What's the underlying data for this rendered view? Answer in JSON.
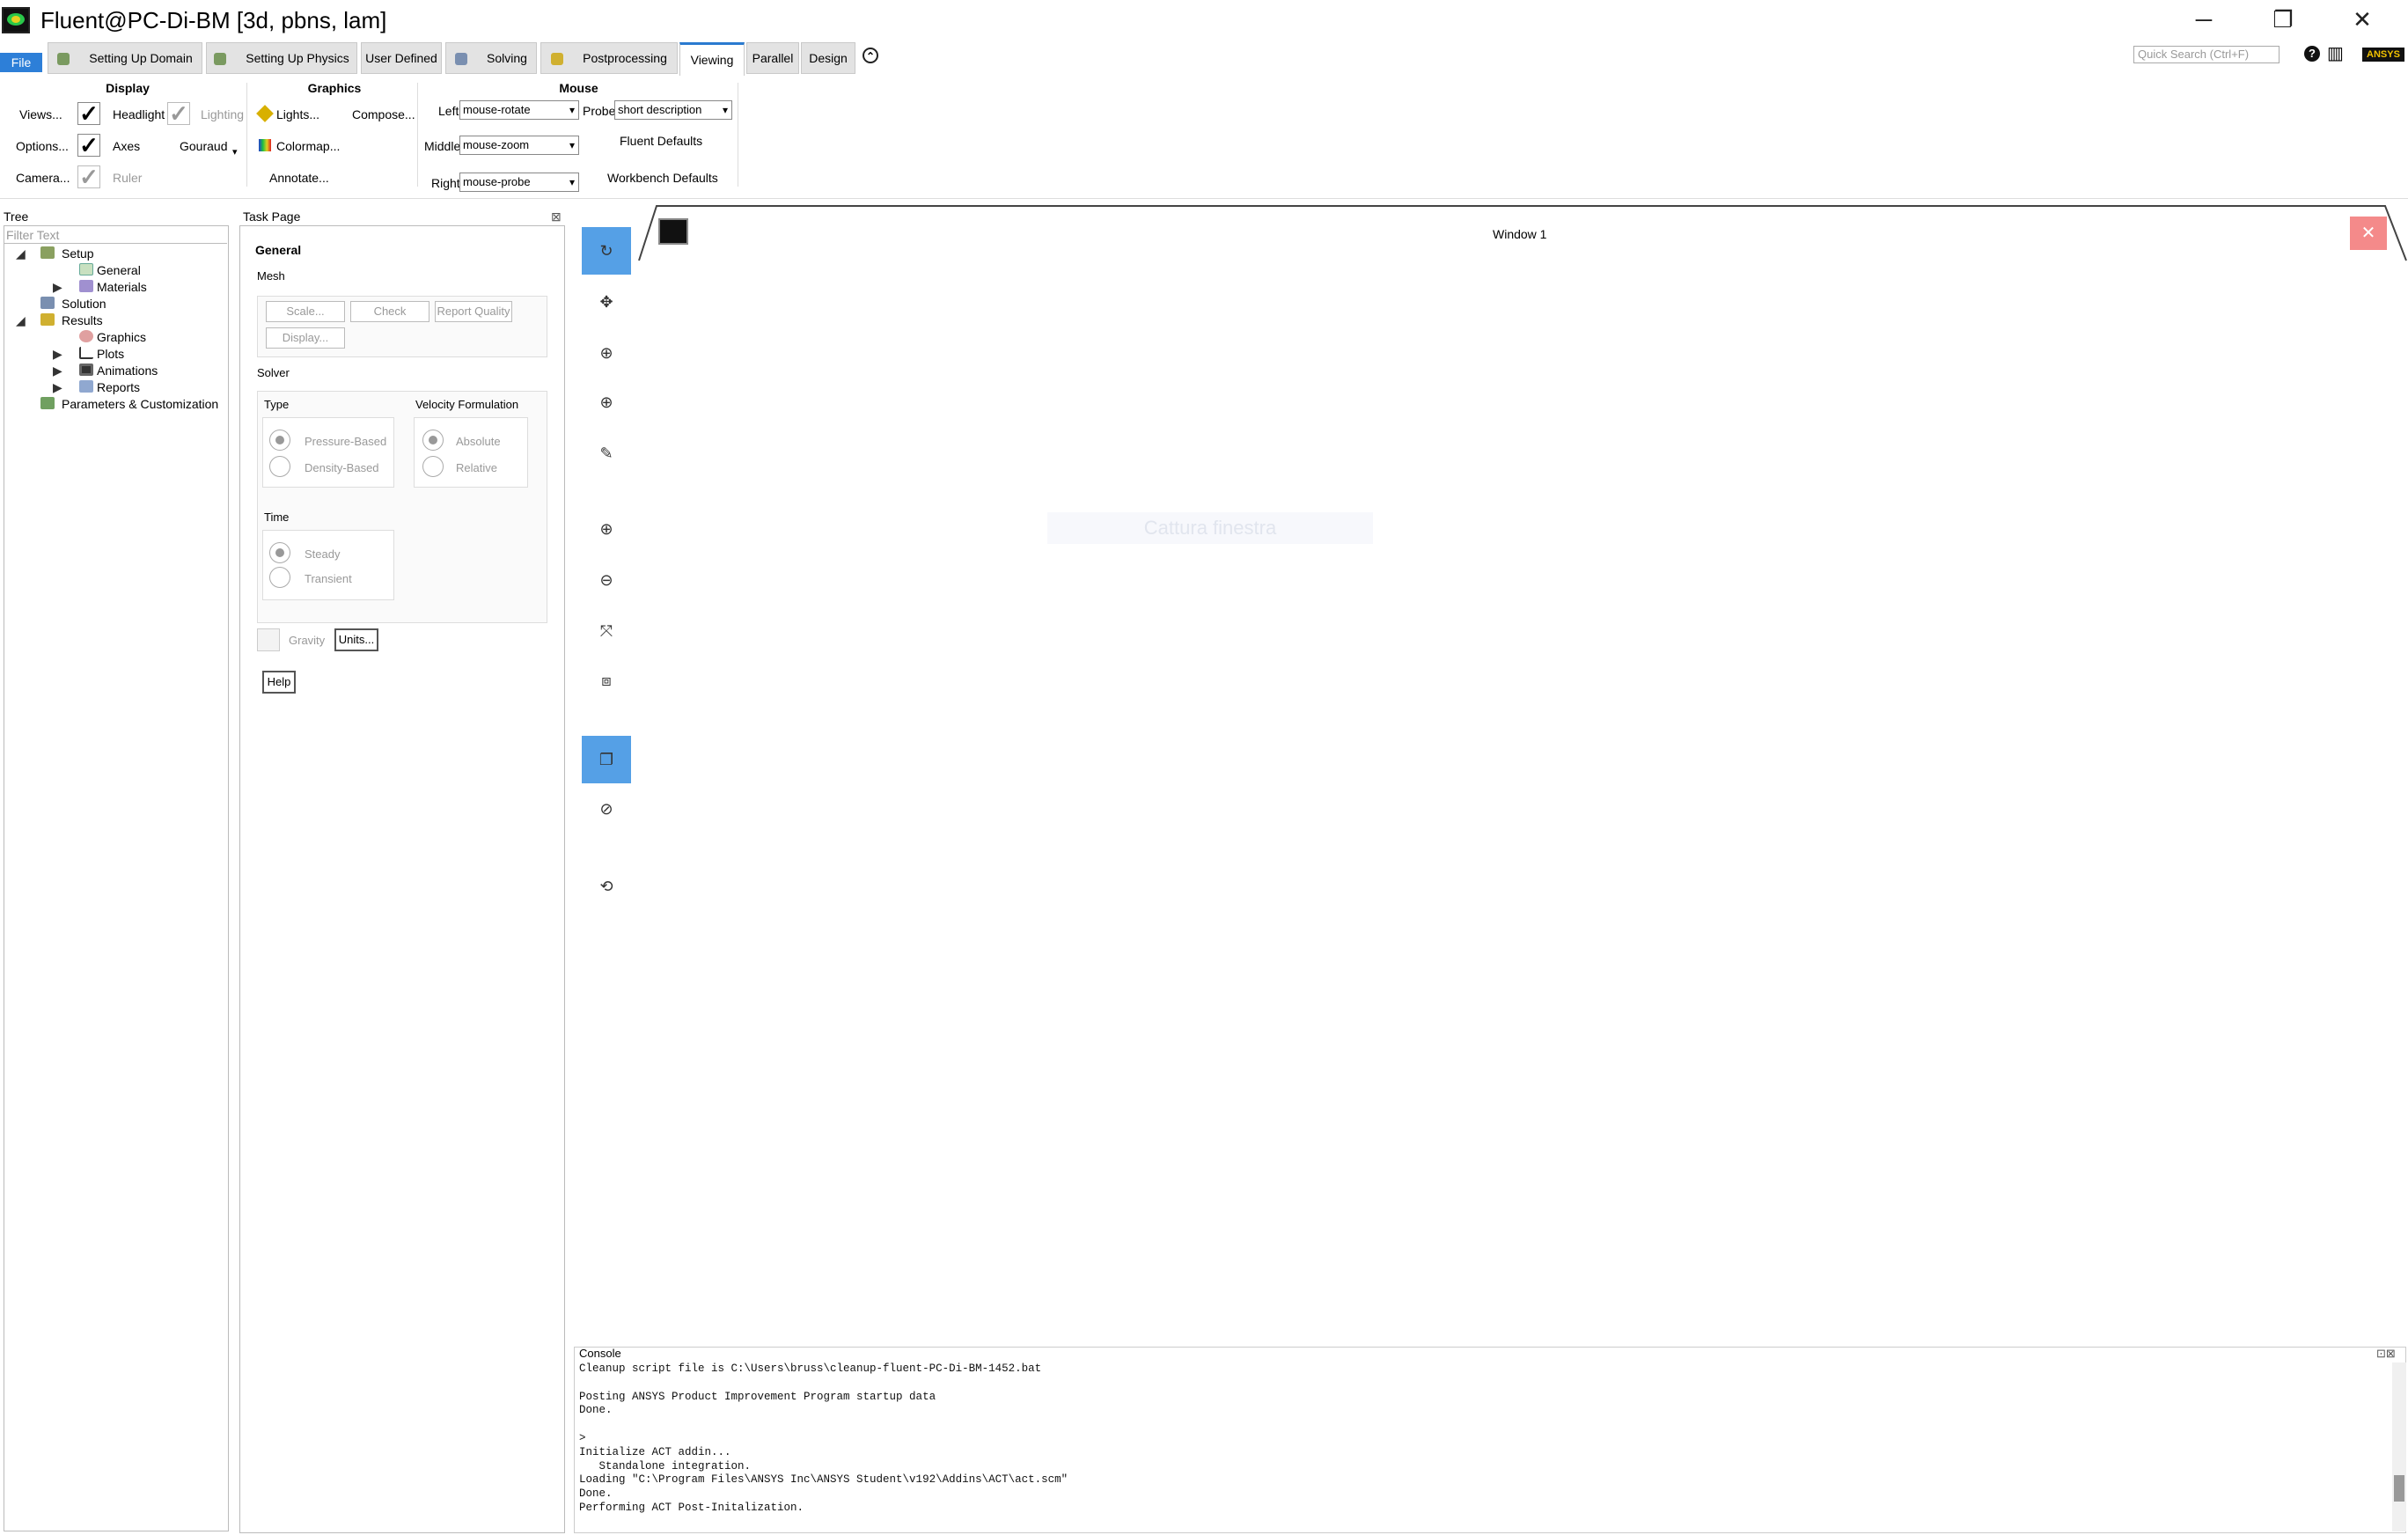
{
  "window": {
    "title": "Fluent@PC-Di-BM  [3d, pbns, lam]",
    "minimize_icon": "minimize-icon",
    "restore_icon": "restore-icon",
    "close_icon": "close-icon",
    "min_glyph": "─",
    "restore_glyph": "❐",
    "close_glyph": "✕"
  },
  "tabs": {
    "file": "File",
    "items": [
      "Setting Up Domain",
      "Setting Up Physics",
      "User Defined",
      "Solving",
      "Postprocessing",
      "Viewing",
      "Parallel",
      "Design"
    ],
    "active": "Viewing",
    "collapse_glyph": "⌃"
  },
  "topright": {
    "search_placeholder": "Quick Search (Ctrl+F)",
    "help_glyph": "?",
    "layout_glyph": "▥",
    "brand": "ANSYS"
  },
  "ribbon": {
    "display": {
      "title": "Display",
      "views": "Views...",
      "options": "Options...",
      "camera": "Camera...",
      "headlight": "Headlight",
      "axes": "Axes",
      "ruler": "Ruler",
      "lighting": "Lighting",
      "gouraud": "Gouraud",
      "gouraud_arrow": "▾"
    },
    "graphics": {
      "title": "Graphics",
      "lights": "Lights...",
      "compose": "Compose...",
      "colormap": "Colormap...",
      "annotate": "Annotate..."
    },
    "mouse": {
      "title": "Mouse",
      "left_label": "Left",
      "left_value": "mouse-rotate",
      "middle_label": "Middle",
      "middle_value": "mouse-zoom",
      "right_label": "Right",
      "right_value": "mouse-probe",
      "probe_label": "Probe",
      "probe_value": "short description",
      "fluent_defaults": "Fluent Defaults",
      "workbench_defaults": "Workbench Defaults"
    }
  },
  "tree": {
    "title": "Tree",
    "filter_placeholder": "Filter Text",
    "items": [
      "Setup",
      "General",
      "Materials",
      "Solution",
      "Results",
      "Graphics",
      "Plots",
      "Animations",
      "Reports",
      "Parameters & Customization"
    ],
    "expanded_glyph": "◢",
    "collapsed_glyph": "▶"
  },
  "task": {
    "title": "Task Page",
    "heading": "General",
    "mesh": "Mesh",
    "scale": "Scale...",
    "check": "Check",
    "report_quality": "Report Quality",
    "display": "Display...",
    "solver": "Solver",
    "type": "Type",
    "pressure_based": "Pressure-Based",
    "density_based": "Density-Based",
    "velocity": "Velocity Formulation",
    "absolute": "Absolute",
    "relative": "Relative",
    "time": "Time",
    "steady": "Steady",
    "transient": "Transient",
    "gravity": "Gravity",
    "units": "Units...",
    "help": "Help",
    "close_glyph": "⊠"
  },
  "graphics_window": {
    "title": "Window 1",
    "tooltip": "Cattura finestra",
    "close_glyph": "✕",
    "tools": [
      "↻",
      "✥",
      "⊕",
      "⊕",
      "✎",
      "⊕",
      "⊖",
      "⤧",
      "⧈",
      "❐",
      "⊘",
      "⟲"
    ]
  },
  "console": {
    "title": "Console",
    "lines": [
      "Cleanup script file is C:\\Users\\bruss\\cleanup-fluent-PC-Di-BM-1452.bat",
      "",
      "Posting ANSYS Product Improvement Program startup data",
      "Done.",
      "",
      "> ",
      "Initialize ACT addin...",
      "   Standalone integration.",
      "Loading \"C:\\Program Files\\ANSYS Inc\\ANSYS Student\\v192\\Addins\\ACT\\act.scm\"",
      "Done.",
      "Performing ACT Post-Initalization."
    ],
    "icons_glyph": "⊡⊠"
  },
  "colors": {
    "accent": "#2d7fd8",
    "tool_active": "#55a0e6",
    "close_red": "#f48a8a"
  }
}
